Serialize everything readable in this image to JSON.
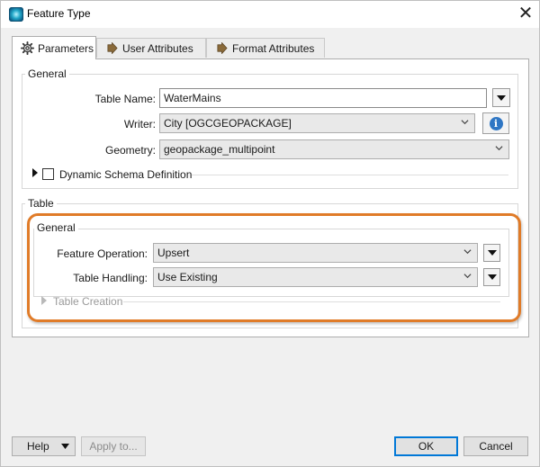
{
  "window": {
    "title": "Feature Type",
    "icon": "fme-globe-icon",
    "close_glyph": "✕"
  },
  "tabs": [
    {
      "label": "Parameters",
      "icon": "gear-icon",
      "active": true
    },
    {
      "label": "User Attributes",
      "icon": "arrow-right-icon",
      "active": false
    },
    {
      "label": "Format Attributes",
      "icon": "arrow-right-icon",
      "active": false
    }
  ],
  "general": {
    "title": "General",
    "table_name": {
      "label": "Table Name:",
      "value": "WaterMains"
    },
    "writer": {
      "label": "Writer:",
      "value": "City [OGCGEOPACKAGE]"
    },
    "geometry": {
      "label": "Geometry:",
      "value": "geopackage_multipoint"
    },
    "dynamic_schema": {
      "label": "Dynamic Schema Definition",
      "checked": false
    }
  },
  "table": {
    "title": "Table",
    "general": {
      "title": "General",
      "feature_operation": {
        "label": "Feature Operation:",
        "value": "Upsert"
      },
      "table_handling": {
        "label": "Table Handling:",
        "value": "Use Existing"
      }
    },
    "table_creation": {
      "label": "Table Creation",
      "enabled": false
    }
  },
  "footer": {
    "help_label": "Help",
    "apply_label": "Apply to...",
    "ok_label": "OK",
    "cancel_label": "Cancel"
  },
  "colors": {
    "highlight": "#e07b28",
    "primary_border": "#0078d7",
    "info_icon": "#2f76c4",
    "tab_arrow": "#8a6a3a"
  }
}
